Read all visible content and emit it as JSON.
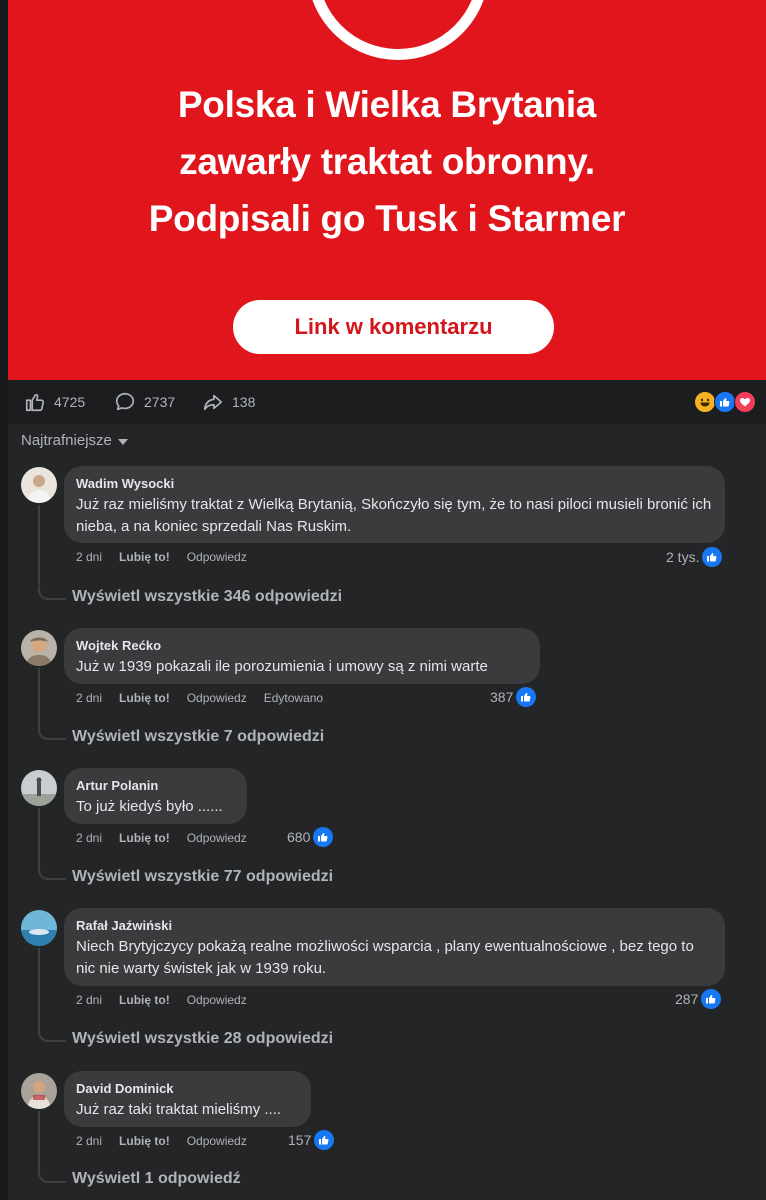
{
  "banner": {
    "headline": [
      "Polska i Wielka Brytania",
      "zawarły traktat obronny.",
      "Podpisali go Tusk i Starmer"
    ],
    "button_label": "Link w komentarzu",
    "background_color": "#e0161c"
  },
  "stats": {
    "likes": "4725",
    "comments": "2737",
    "shares": "138",
    "reactions": [
      "haha-icon",
      "like-icon",
      "love-icon"
    ]
  },
  "sort": {
    "label": "Najtrafniejsze"
  },
  "comments": [
    {
      "author": "Wadim Wysocki",
      "text": "Już raz mieliśmy traktat z Wielką Brytanią, Skończyło się tym, że to nasi piloci musieli bronić ich nieba, a na koniec sprzedali Nas Ruskim.",
      "time": "2 dni",
      "like": "Lubię to!",
      "reply": "Odpowiedz",
      "edited": "",
      "reactions": "2 tys.",
      "view_replies": "Wyświetl wszystkie 346 odpowiedzi"
    },
    {
      "author": "Wojtek Rećko",
      "text": "Już w 1939 pokazali ile porozumienia i umowy są z nimi warte",
      "time": "2 dni",
      "like": "Lubię to!",
      "reply": "Odpowiedz",
      "edited": "Edytowano",
      "reactions": "387",
      "view_replies": "Wyświetl wszystkie 7 odpowiedzi"
    },
    {
      "author": "Artur Polanin",
      "text": "To już kiedyś było ......",
      "time": "2 dni",
      "like": "Lubię to!",
      "reply": "Odpowiedz",
      "edited": "",
      "reactions": "680",
      "view_replies": "Wyświetl wszystkie 77 odpowiedzi"
    },
    {
      "author": "Rafał Jaźwiński",
      "text": "Niech Brytyjczycy pokażą realne możliwości wsparcia , plany ewentualnościowe , bez tego to nic nie warty świstek jak w 1939 roku.",
      "time": "2 dni",
      "like": "Lubię to!",
      "reply": "Odpowiedz",
      "edited": "",
      "reactions": "287",
      "view_replies": "Wyświetl wszystkie 28 odpowiedzi"
    },
    {
      "author": "David Dominick",
      "text": "Już raz taki traktat mieliśmy ....",
      "time": "2 dni",
      "like": "Lubię to!",
      "reply": "Odpowiedz",
      "edited": "",
      "reactions": "157",
      "view_replies": "Wyświetl 1 odpowiedź"
    }
  ]
}
